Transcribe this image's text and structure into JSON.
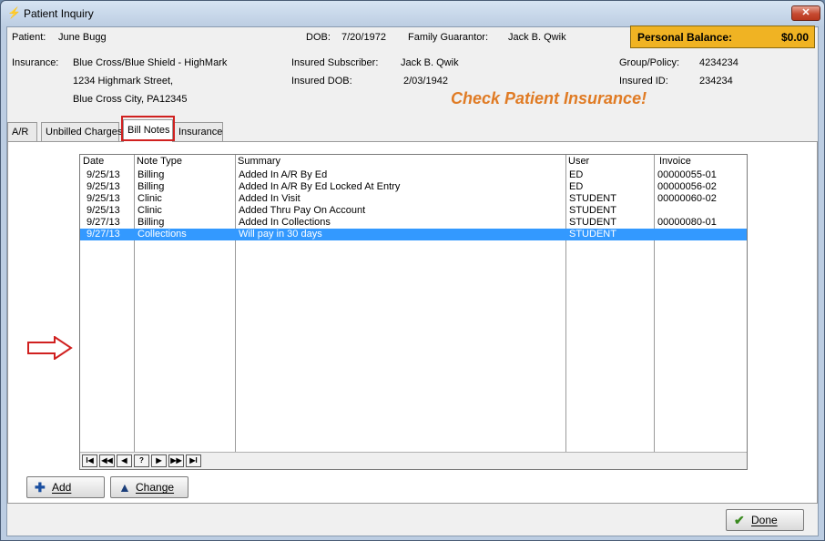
{
  "window": {
    "title": "Patient Inquiry",
    "close": "✕"
  },
  "header": {
    "patient_label": "Patient:",
    "patient_value": "June Bugg",
    "dob_label": "DOB:",
    "dob_value": "7/20/1972",
    "guarantor_label": "Family Guarantor:",
    "guarantor_value": "Jack B. Qwik",
    "balance_label": "Personal Balance:",
    "balance_value": "$0.00",
    "insurance_label": "Insurance:",
    "insurance_line1": "Blue Cross/Blue Shield - HighMark",
    "insurance_line2": "1234 Highmark Street,",
    "insurance_line3": "Blue Cross City, PA12345",
    "subscriber_label": "Insured Subscriber:",
    "subscriber_value": "Jack B. Qwik",
    "insured_dob_label": "Insured DOB:",
    "insured_dob_value": "2/03/1942",
    "group_label": "Group/Policy:",
    "group_value": "4234234",
    "insured_id_label": "Insured ID:",
    "insured_id_value": "234234",
    "alert": "Check Patient Insurance!",
    "balance_color": "#f0b323",
    "alert_color": "#e07b24"
  },
  "tabs": [
    "A/R",
    "Unbilled Charges",
    "Bill Notes",
    "Insurance"
  ],
  "active_tab": "Bill Notes",
  "grid": {
    "columns": [
      "Date",
      "Note Type",
      "Summary",
      "User",
      "Invoice"
    ],
    "rows": [
      [
        "9/25/13",
        "Billing",
        "Added In A/R By Ed",
        "ED",
        "00000055-01"
      ],
      [
        "9/25/13",
        "Billing",
        "Added In A/R By Ed Locked At Entry",
        "ED",
        "00000056-02"
      ],
      [
        "9/25/13",
        "Clinic",
        "Added In Visit",
        "STUDENT",
        "00000060-02"
      ],
      [
        "9/25/13",
        "Clinic",
        "Added Thru Pay On Account",
        "STUDENT",
        ""
      ],
      [
        "9/27/13",
        "Billing",
        "Added In Collections",
        "STUDENT",
        "00000080-01"
      ],
      [
        "9/27/13",
        "Collections",
        "Will pay in 30 days",
        "STUDENT",
        ""
      ]
    ],
    "selected_row": 5,
    "nav": [
      "I◀",
      "◀◀",
      "◀",
      "?",
      "▶",
      "▶▶",
      "▶I"
    ]
  },
  "buttons": {
    "add": "Add",
    "change": "Change",
    "done": "Done"
  },
  "icons": {
    "add": "plus-icon",
    "change": "triangle-up-icon",
    "done": "checkmark-icon",
    "pointer": "right-arrow-icon"
  }
}
